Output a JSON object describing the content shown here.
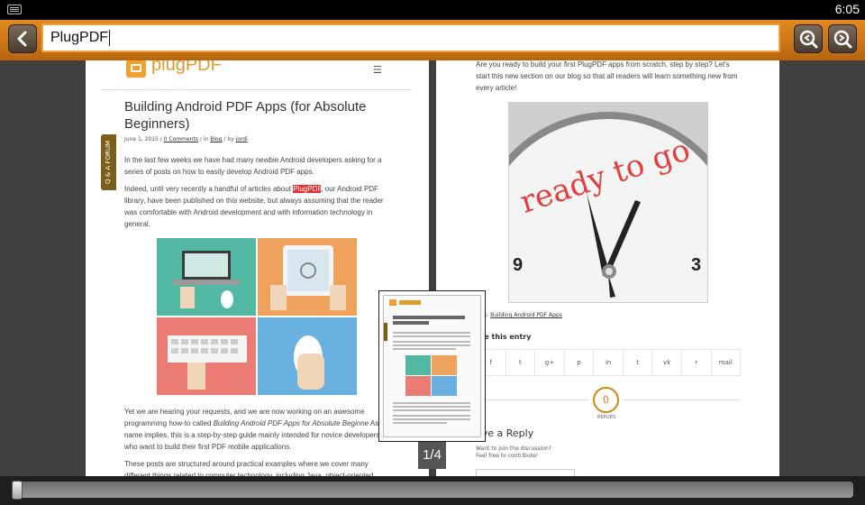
{
  "status_bar": {
    "time": "6:05",
    "keyboard_icon": "keyboard-icon"
  },
  "toolbar": {
    "search_value": "PlugPDF",
    "back_icon": "chevron-left-icon",
    "prev_icon": "zoom-previous-icon",
    "next_icon": "zoom-next-icon",
    "accent_color": "#d67e1a"
  },
  "left_page": {
    "logo_text": "plugPDF",
    "qa_tab": "Q & A FORUM",
    "title": "Building Android PDF Apps (for Absolute Beginners)",
    "meta": {
      "date": "June 1, 2015",
      "comments": "0 Comments",
      "category": "Blog",
      "author": "jordi",
      "in": "in",
      "by": "by"
    },
    "para1": "In the last few weeks we have had many newbie Android developers asking for a series of posts on how to easily develop Android PDF apps.",
    "para2_before": "Indeed, until very recently a handful of articles about ",
    "para2_highlight": "PlugPDF",
    "para2_after": ", our Android PDF library, have been published on this website, but always assuming that the reader was comfortable with Android development and with information technology in general.",
    "para3_a": "Yet we are hearing your requests, and we are now working on an awesome programming how-to called ",
    "para3_em": "Building Android PDF Apps for Absolute Beginne",
    "para3_b": "As its name implies, this is a step-by-step guide mainly intended for novice developers who want to build their first PDF mobile applications.",
    "para4": "These posts are structured around practical examples where we cover many different things related to computer technology, including Java, object-oriented"
  },
  "right_page": {
    "intro": "Are you ready to build your first PlugPDF apps from scratch, step by step? Let's start this new section on our blog so that all readers will learn something new from every article!",
    "clock_text": "ready to go",
    "clock_nine": "9",
    "clock_three": "3",
    "tags_prefix": "s:",
    "tags_link": "Building Android PDF Apps",
    "share_title": "are this entry",
    "share_icons": [
      "f",
      "t",
      "g+",
      "p",
      "in",
      "t",
      "vk",
      "r",
      "mail"
    ],
    "reply_count": "0",
    "replies_label": "REPLIES",
    "leave_reply": "ave a Reply",
    "join1": "Want to join the discussion?",
    "join2": "Feel free to contribute!"
  },
  "page_indicator": "1/4",
  "slider_position": 0.0
}
